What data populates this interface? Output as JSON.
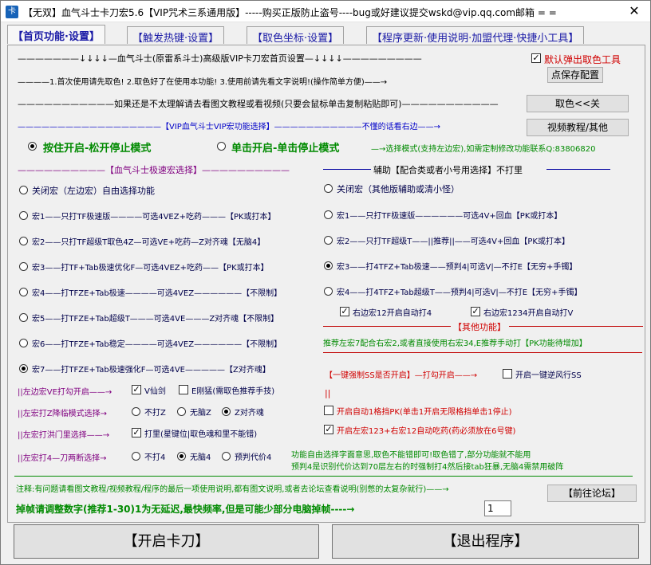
{
  "window": {
    "title": "【无双】血气斗士卡刀宏5.6【VIP咒术三系通用版】-----购买正版防止盗号----bug或好建议提交wskd@vip.qq.com邮箱 = =",
    "close": "✕"
  },
  "tabs": [
    "【首页功能·设置】",
    "【触发热键·设置】",
    "【取色坐标·设置】",
    "【程序更新·使用说明·加盟代理·快捷小工具】"
  ],
  "header": {
    "line1": "———————↓↓↓↓—血气斗士(原雷系斗士)高级版VIP卡刀宏首页设置—↓↓↓↓—————————",
    "line2": "————1.首次使用请先取色!  2.取色好了在使用本功能!   3.使用前请先看文字说明!(操作简单方便)——→",
    "line3": "———————————如果还是不太理解请去看图文教程或看视频(只要会鼠标单击复制粘贴即可)———————————",
    "line4": "——————————————————【VIP血气斗士VIP宏功能选择】———————————不懂的话看右边——→",
    "default_color_label": "默认弹出取色工具",
    "save_btn": "点保存配置",
    "pick_btn": "取色<<关",
    "video_btn": "视频教程/其他"
  },
  "mode": {
    "opt1": "按住开启-松开停止模式",
    "opt2": "单击开启-单击停止模式",
    "note": "—→选择模式(支持左边宏),如需定制修改功能联系Q:83806820"
  },
  "left_group": {
    "title": "——————————【血气斗士极速宏选择】——————————",
    "items": [
      "关闭宏（左边宏）自由选择功能",
      "宏1——只打TF极速版————可选4VEZ+吃药———【PK或打本】",
      "宏2——只打TF超级T取色4Z—可选VE+吃药—Z对齐魂【无脑4】",
      "宏3——打TF+Tab极速优化F—可选4VEZ+吃药——【PK或打本】",
      "宏4——打TFZE+Tab极速————可选4VEZ——————【不限制】",
      "宏5——打TFZE+Tab超级T———可选4VE———Z对齐魂【不限制】",
      "宏6——打TFZE+Tab稳定————可选4VEZ——————【不限制】",
      "宏7——打TFZE+Tab极速强化F—可选4VE—————【Z对齐魂】"
    ]
  },
  "right_group": {
    "title": "辅助【配合类或者小号用选择】不打里",
    "items": [
      "关闭宏（其他版辅助或清小怪）",
      "宏1——只打TF极速版——————可选4V+回血【PK或打本】",
      "宏2——只打TF超级T——||推荐||——可选4V+回血【PK或打本】",
      "宏3——打4TFZ+Tab极速——预判4|可选V|—不打E【无穷+手镯】",
      "宏4——打4TFZ+Tab超级T——预判4|可选V|—不打E【无穷+手镯】"
    ],
    "chk1": "右边宏12开启自动打4",
    "chk2": "右边宏1234开启自动打V"
  },
  "other": {
    "title": "【其他功能】",
    "desc": "推荐左宏7配合右宏2,或者直接使用右宏34,E推荐手动打【PK功能待增加】",
    "force_label": "【一键强制SS是否开启】—打勾开启——→",
    "force_chk": "开启一键逆风行SS",
    "bars": "||",
    "auto1": "开启自动1格挡PK(单击1开启无限格挡单击1停止)",
    "auto2": "开启左宏123+右宏12自动吃药(药必须放在6号键)"
  },
  "options": {
    "row1_label": "||左边宏VE打勾开启——→",
    "row1_a": "V仙剑",
    "row1_b": "E刚猛(需取色推荐手技)",
    "row2_label": "||左宏打Z降临模式选择→",
    "row2_a": "不打Z",
    "row2_b": "无脑Z",
    "row2_c": "Z对齐魂",
    "row3_label": "||左宏打洪门里选择——→",
    "row3_a": "打里(星键位|取色魂和里不能错)",
    "row4_label": "||左宏打4—刀两断选择→",
    "row4_a": "不打4",
    "row4_b": "无脑4",
    "row4_c": "预判代价4"
  },
  "hint": {
    "line1": "功能自由选择字面意思,取色不能错即可!取色错了,部分功能就不能用",
    "line2": "预判4是识别代价达到70层左右的时强制打4然后接tab狂暴,无脑4需禁用破阵"
  },
  "footer": {
    "note": "注释:有问题请看图文教程/视频教程/程序的最后一项使用说明,都有图文说明,或者去论坛查看说明(别憋的太复杂就行)——→",
    "forum_btn": "【前往论坛】",
    "frame_label": "掉帧请调整数字(推荐1-30)1为无延迟,最快频率,但是可能少部分电脑掉帧----→",
    "frame_value": "1",
    "start_btn": "【开启卡刀】",
    "exit_btn": "【退出程序】"
  }
}
